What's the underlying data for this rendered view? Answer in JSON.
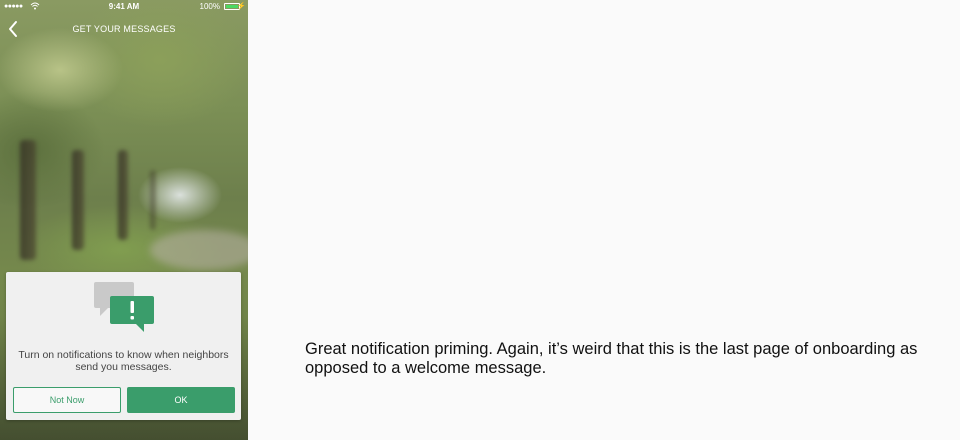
{
  "statusbar": {
    "signal": "●●●●●",
    "time": "9:41 AM",
    "battery_percent": "100%",
    "battery_level": 1.0
  },
  "navbar": {
    "title": "GET YOUR MESSAGES",
    "back_icon": "chevron-left-icon"
  },
  "card": {
    "icon": "chat-bubbles-alert-icon",
    "message": "Turn on notifications to know when neighbors send you messages.",
    "not_now_label": "Not Now",
    "ok_label": "OK"
  },
  "colors": {
    "accent_green": "#3a9d6b",
    "card_bg": "#f0f0f0",
    "battery_green": "#4cd964"
  },
  "comment": {
    "text": "Great notification priming. Again, it’s weird that this is the last page of onboarding as opposed to a welcome message."
  }
}
